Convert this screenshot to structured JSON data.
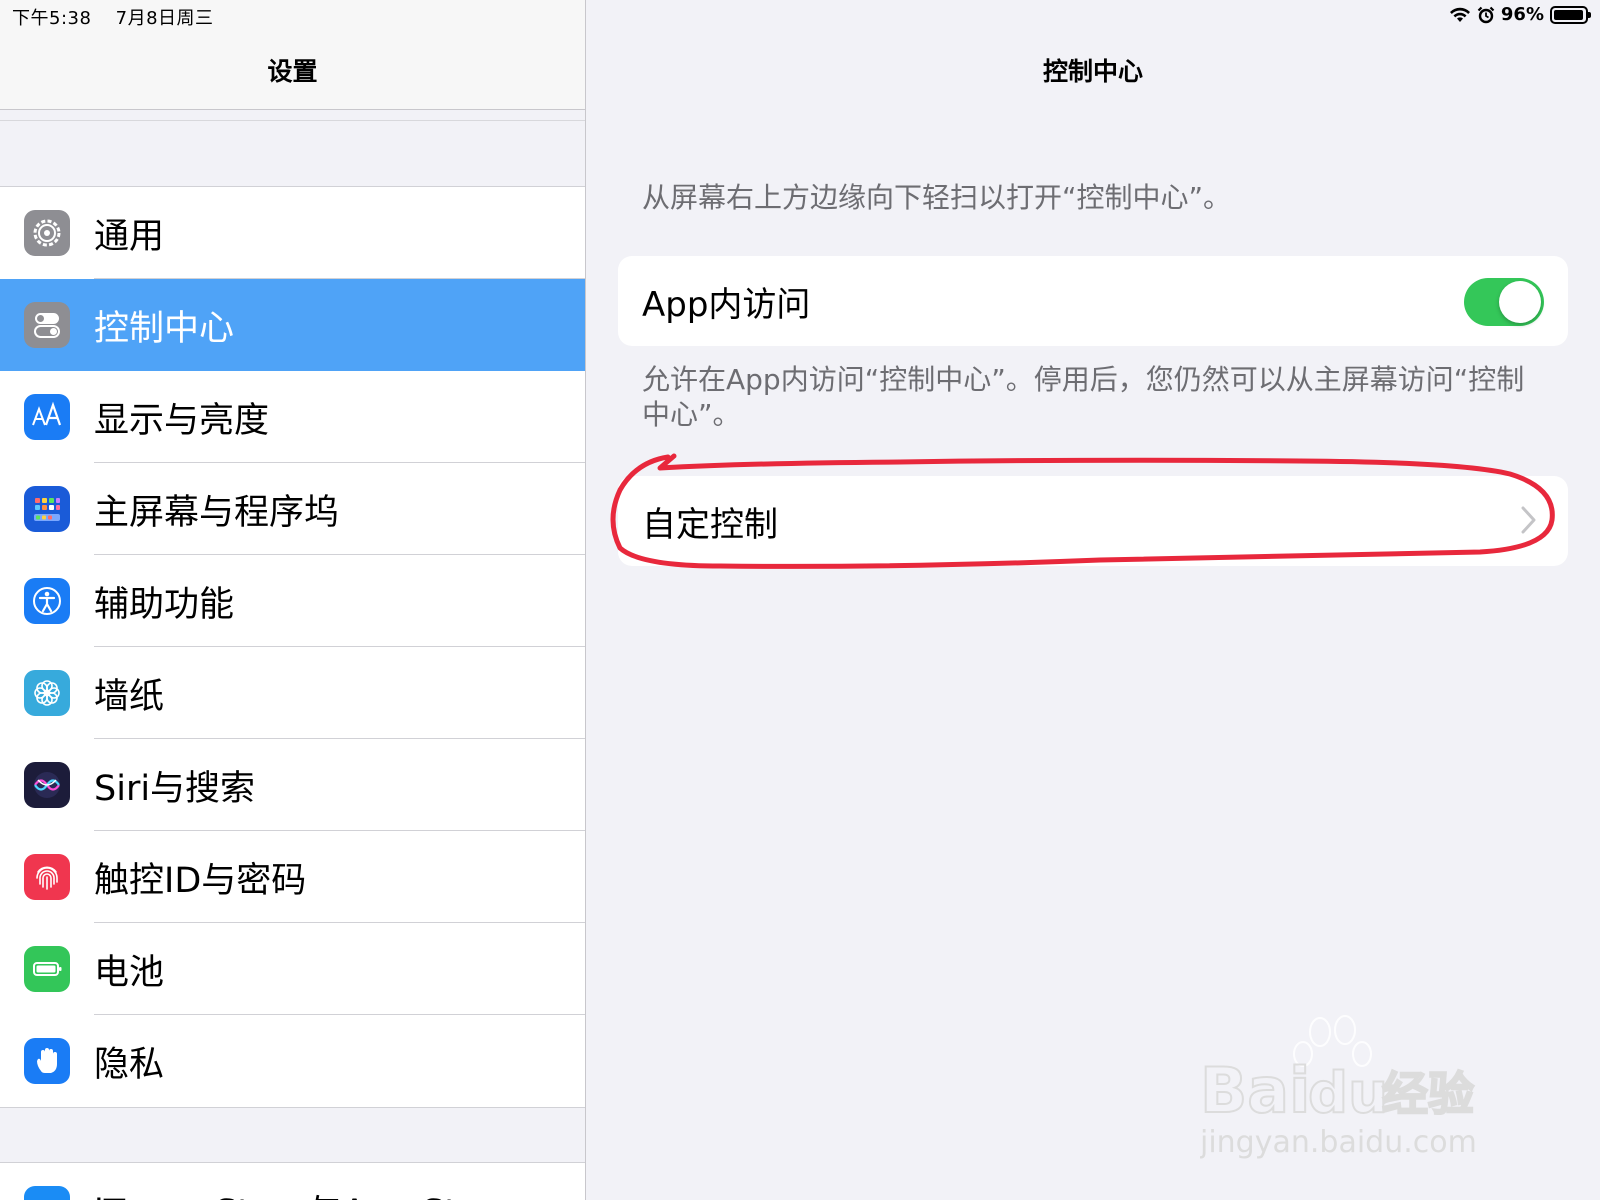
{
  "status_bar": {
    "time": "下午5:38",
    "date": "7月8日周三",
    "battery_percent": "96%",
    "battery_level": 0.96
  },
  "sidebar": {
    "title": "设置",
    "items": [
      {
        "label": "通用",
        "icon": "gear-icon",
        "color": "#8e8e93"
      },
      {
        "label": "控制中心",
        "icon": "switches-icon",
        "color": "#8e8e93",
        "selected": true
      },
      {
        "label": "显示与亮度",
        "icon": "text-size-icon",
        "color": "#1a7cf5"
      },
      {
        "label": "主屏幕与程序坞",
        "icon": "home-grid-icon",
        "color": "#1a5bd8"
      },
      {
        "label": "辅助功能",
        "icon": "accessibility-icon",
        "color": "#1a7cf5"
      },
      {
        "label": "墙纸",
        "icon": "flower-icon",
        "color": "#37aadc"
      },
      {
        "label": "Siri与搜索",
        "icon": "siri-icon",
        "color": "#1c1c3a"
      },
      {
        "label": "触控ID与密码",
        "icon": "fingerprint-icon",
        "color": "#f0364f"
      },
      {
        "label": "电池",
        "icon": "battery-icon",
        "color": "#33c659"
      },
      {
        "label": "隐私",
        "icon": "hand-icon",
        "color": "#1a7cf5"
      }
    ],
    "next_item": {
      "label": "iTunes Store与App Store",
      "icon": "app-store-icon",
      "color": "#1a8cf5"
    }
  },
  "detail": {
    "title": "控制中心",
    "intro": "从屏幕右上方边缘向下轻扫以打开“控制中心”。",
    "app_access": {
      "label": "App内访问",
      "enabled": true
    },
    "app_access_footnote": "允许在App内访问“控制中心”。停用后，您仍然可以从主屏幕访问“控制中心”。",
    "customize": {
      "label": "自定控制"
    }
  },
  "colors": {
    "accent": "#4fa3f7",
    "toggle_on": "#34c759",
    "annotation": "#e8283c"
  },
  "watermark": {
    "brand": "Bai",
    "brand_cn": "经验",
    "url": "jingyan.baidu.com"
  }
}
